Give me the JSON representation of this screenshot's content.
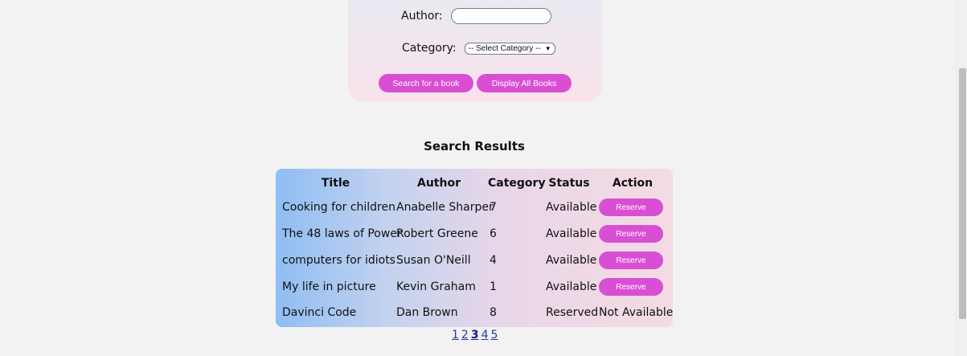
{
  "search_form": {
    "author_label": "Author:",
    "author_value": "",
    "category_label": "Category:",
    "category_selected": "-- Select Category --",
    "search_button": "Search for a book",
    "display_all_button": "Display All Books"
  },
  "results": {
    "heading": "Search Results",
    "columns": [
      "Title",
      "Author",
      "Category",
      "Status",
      "Action"
    ],
    "rows": [
      {
        "title": "Cooking for children",
        "author": "Anabelle Sharper",
        "category": "7",
        "status": "Available",
        "action": "Reserve"
      },
      {
        "title": "The 48 laws of Power",
        "author": "Robert Greene",
        "category": "6",
        "status": "Available",
        "action": "Reserve"
      },
      {
        "title": "computers for idiots",
        "author": "Susan O'Neill",
        "category": "4",
        "status": "Available",
        "action": "Reserve"
      },
      {
        "title": "My life in picture",
        "author": "Kevin Graham",
        "category": "1",
        "status": "Available",
        "action": "Reserve"
      },
      {
        "title": "Davinci Code",
        "author": "Dan Brown",
        "category": "8",
        "status": "Reserved",
        "action": "Not Available"
      }
    ]
  },
  "pagination": {
    "pages": [
      "1",
      "2",
      "3",
      "4",
      "5"
    ],
    "current": "3"
  },
  "colors": {
    "accent": "#d94fd4",
    "link": "#2a36a8"
  }
}
